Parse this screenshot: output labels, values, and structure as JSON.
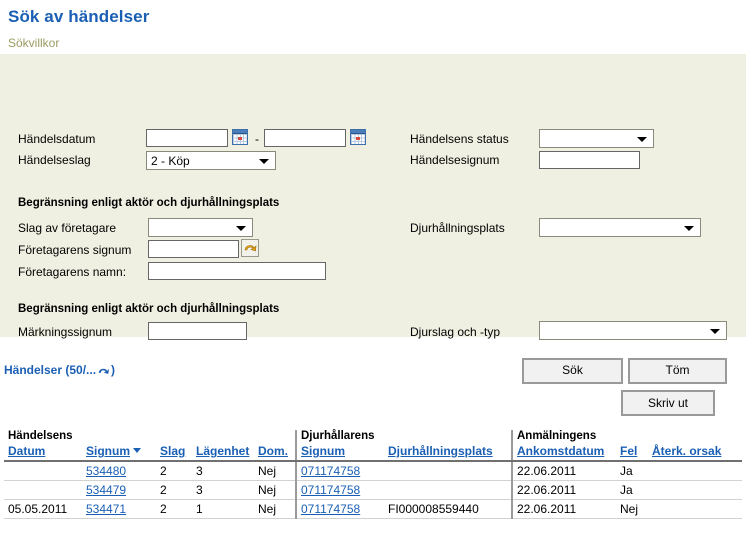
{
  "page": {
    "title": "Sök av händelser",
    "search_section_label": "Sökvillkor"
  },
  "search_form": {
    "event_date_label": "Händelsdatum",
    "event_date_from_value": "",
    "event_date_to_value": "",
    "date_range_separator": "-",
    "calendar_icon": "calendar-icon",
    "event_type_label": "Händelseslag",
    "event_type_value": "2 - Köp",
    "event_status_label": "Händelsens status",
    "event_status_value": "",
    "event_signum_label": "Händelsesignum",
    "event_signum_value": "",
    "group1_title": "Begränsning enligt aktör och djurhållningsplats",
    "operator_type_label": "Slag av företagare",
    "operator_type_value": "",
    "operator_signum_label": "Företagarens signum",
    "operator_signum_value": "",
    "operator_lookup_icon": "search-arrow-icon",
    "operator_name_label": "Företagarens namn:",
    "operator_name_value": "",
    "holding_place_label": "Djurhållningsplats",
    "holding_place_value": "",
    "group2_title": "Begränsning enligt aktör och djurhållningsplats",
    "marking_signum_label": "Märkningssignum",
    "marking_signum_value": "",
    "animal_species_label": "Djurslag och -typ",
    "animal_species_value": "",
    "search_button": "Sök",
    "clear_button": "Töm"
  },
  "results": {
    "heading_prefix": "Händelser (50/...",
    "heading_suffix": ")",
    "refresh_icon": "refresh-arrow-icon",
    "print_button": "Skriv ut",
    "group_headers": {
      "event": "Händelsens",
      "keeper": "Djurhållarens",
      "notification": "Anmälningens"
    },
    "columns": [
      {
        "key": "datum",
        "label": "Datum",
        "link": true
      },
      {
        "key": "signum",
        "label": "Signum",
        "link": true,
        "sorted": "desc"
      },
      {
        "key": "slag",
        "label": "Slag",
        "link": true
      },
      {
        "key": "lagenhet",
        "label": "Lägenhet",
        "link": true
      },
      {
        "key": "dom",
        "label": "Dom.",
        "link": true
      },
      {
        "key": "keeper_signum",
        "label": "Signum",
        "link": true
      },
      {
        "key": "djurhallningsplats",
        "label": "Djurhållningsplats",
        "link": true
      },
      {
        "key": "ankomstdatum",
        "label": "Ankomstdatum",
        "link": true
      },
      {
        "key": "fel",
        "label": "Fel",
        "link": true
      },
      {
        "key": "aterk_orsak",
        "label": "Återk. orsak",
        "link": true
      }
    ],
    "rows": [
      {
        "datum": "",
        "signum": "534480",
        "slag": "2",
        "lagenhet": "3",
        "dom": "Nej",
        "keeper_signum": "071174758",
        "djurhallningsplats": "",
        "ankomstdatum": "22.06.2011",
        "fel": "Ja",
        "aterk_orsak": ""
      },
      {
        "datum": "",
        "signum": "534479",
        "slag": "2",
        "lagenhet": "3",
        "dom": "Nej",
        "keeper_signum": "071174758",
        "djurhallningsplats": "",
        "ankomstdatum": "22.06.2011",
        "fel": "Ja",
        "aterk_orsak": ""
      },
      {
        "datum": "05.05.2011",
        "signum": "534471",
        "slag": "2",
        "lagenhet": "1",
        "dom": "Nej",
        "keeper_signum": "071174758",
        "djurhallningsplats": "FI000008559440",
        "ankomstdatum": "22.06.2011",
        "fel": "Nej",
        "aterk_orsak": ""
      }
    ]
  },
  "colors": {
    "link": "#1a5fb4",
    "panel_bg": "#f0f0e2",
    "section_label": "#9b9b63"
  }
}
